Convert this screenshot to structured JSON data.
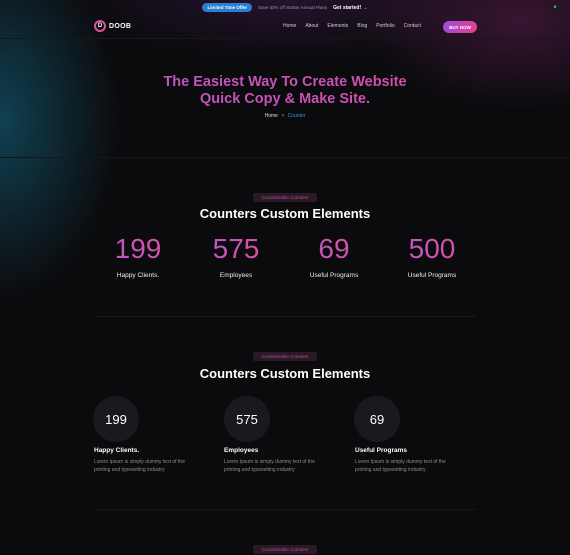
{
  "topbar": {
    "badge": "Limited Time Offer",
    "text": "Save 50% off Starter Annual Plans",
    "link": "Get started!",
    "link_arrow": "→",
    "close": "×"
  },
  "header": {
    "logo_mark": "D",
    "logo_text": "DOOB",
    "nav": [
      "Home",
      "About",
      "Elements",
      "Blog",
      "Portfolio",
      "Contact"
    ],
    "buy": "BUY NOW"
  },
  "hero": {
    "title_line1": "The Easiest Way To Create Website",
    "title_line2": "Quick Copy & Make Site.",
    "crumb_home": "Home",
    "crumb_sep": ">",
    "crumb_current": "Counter"
  },
  "section1": {
    "tag": "Customizable Counters",
    "title": "Counters Custom Elements",
    "counters": [
      {
        "value": "199",
        "label": "Happy Clients."
      },
      {
        "value": "575",
        "label": "Employees"
      },
      {
        "value": "69",
        "label": "Useful Programs"
      },
      {
        "value": "500",
        "label": "Useful Programs"
      }
    ]
  },
  "section2": {
    "tag": "Customizable Counters",
    "title": "Counters Custom Elements",
    "counters": [
      {
        "value": "199",
        "title": "Happy Clients.",
        "desc_line1": "Lorem Ipsum is simply dummy text of the",
        "desc_line2": "printing and typesetting industry"
      },
      {
        "value": "575",
        "title": "Employees",
        "desc_line1": "Lorem Ipsum is simply dummy text of the",
        "desc_line2": "printing and typesetting industry"
      },
      {
        "value": "69",
        "title": "Useful Programs",
        "desc_line1": "Lorem Ipsum is simply dummy text of the",
        "desc_line2": "printing and typesetting industry"
      }
    ]
  },
  "section3": {
    "tag": "Customizable Counters"
  },
  "colors": {
    "accent_pink": "#e0418f",
    "accent_purple": "#a24adc",
    "link_blue": "#3f8fe0",
    "badge_blue": "#2a7fd4"
  }
}
